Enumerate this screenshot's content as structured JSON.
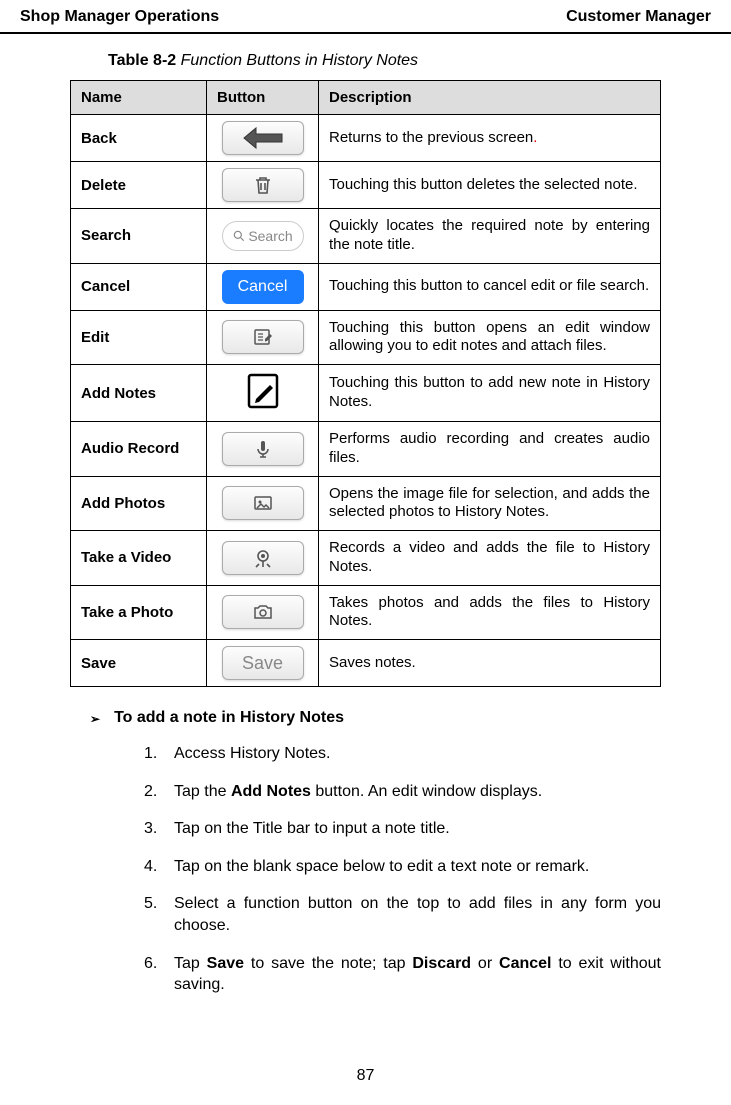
{
  "header": {
    "left": "Shop Manager Operations",
    "right": "Customer Manager"
  },
  "table": {
    "caption_bold": "Table 8-2",
    "caption_italic": " Function Buttons in History Notes",
    "cols": {
      "name": "Name",
      "button": "Button",
      "description": "Description"
    },
    "rows": [
      {
        "name": "Back",
        "icon": "back",
        "desc_pre": "Returns to the previous screen",
        "desc_red": ".",
        "desc_post": ""
      },
      {
        "name": "Delete",
        "icon": "trash",
        "desc": "Touching this button deletes the selected note."
      },
      {
        "name": "Search",
        "icon": "search",
        "desc": "Quickly locates the required note by entering the note title."
      },
      {
        "name": "Cancel",
        "icon": "cancel",
        "desc": "Touching this button to cancel edit or file search."
      },
      {
        "name": "Edit",
        "icon": "edit",
        "desc": "Touching this button opens an edit window allowing you to edit notes and attach files."
      },
      {
        "name": "Add Notes",
        "icon": "addnote",
        "desc": "Touching this button to add new note in History Notes."
      },
      {
        "name": "Audio Record",
        "icon": "mic",
        "desc": "Performs audio recording and creates audio files."
      },
      {
        "name": "Add Photos",
        "icon": "image",
        "desc": "Opens the image file for selection, and adds the selected photos to History Notes."
      },
      {
        "name": "Take a Video",
        "icon": "video",
        "desc": "Records a video and adds the file to History Notes."
      },
      {
        "name": "Take a Photo",
        "icon": "camera",
        "desc": "Takes photos and adds the files to History Notes."
      },
      {
        "name": "Save",
        "icon": "save",
        "desc": "Saves notes."
      }
    ],
    "search_label": "Search",
    "cancel_label": "Cancel",
    "save_label": "Save"
  },
  "howto": {
    "title": "To add a note in History Notes",
    "steps": [
      {
        "n": "1.",
        "text": "Access History Notes."
      },
      {
        "n": "2.",
        "pre": "Tap the ",
        "b1": "Add Notes",
        "post": " button. An edit window displays."
      },
      {
        "n": "3.",
        "text": "Tap on the Title bar to input a note title."
      },
      {
        "n": "4.",
        "text": "Tap on the blank space below to edit a text note or remark."
      },
      {
        "n": "5.",
        "text": "Select a function button on the top to add files in any form you choose."
      },
      {
        "n": "6.",
        "pre": "Tap ",
        "b1": "Save",
        "mid": " to save the note; tap ",
        "b2": "Discard",
        "mid2": " or ",
        "b3": "Cancel",
        "post": " to exit without saving."
      }
    ]
  },
  "page_number": "87"
}
